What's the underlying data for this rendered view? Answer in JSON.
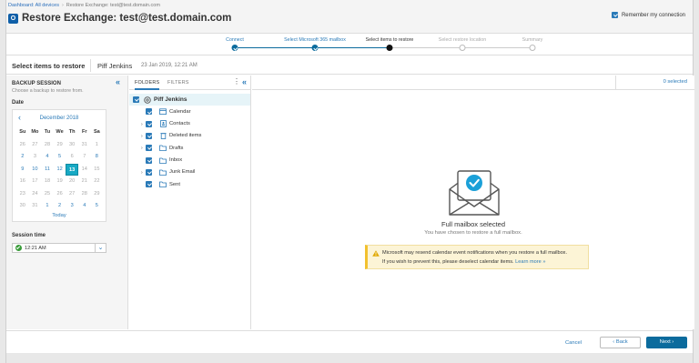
{
  "breadcrumb": {
    "link": "Dashboard: All devices",
    "current": "Restore Exchange: test@test.domain.com"
  },
  "app": {
    "logo_letter": "O",
    "title": "Restore Exchange: test@test.domain.com"
  },
  "remember": {
    "label": "Remember my connection",
    "checked": true
  },
  "steps": [
    {
      "label": "Connect",
      "state": "done"
    },
    {
      "label": "Select Microsoft 365 mailbox",
      "state": "done"
    },
    {
      "label": "Select items to restore",
      "state": "current"
    },
    {
      "label": "Select restore location",
      "state": "future"
    },
    {
      "label": "Summary",
      "state": "future"
    }
  ],
  "header": {
    "title": "Select items to restore",
    "user": "Piff Jenkins",
    "date": "23 Jan 2019, 12:21 AM"
  },
  "backup_session": {
    "title": "BACKUP SESSION",
    "subtitle": "Choose a backup to restore from.",
    "date_label": "Date",
    "session_time_label": "Session time",
    "session_time_value": "12:21 AM"
  },
  "calendar": {
    "month": "December 2018",
    "prev_icon": "‹",
    "weekdays": [
      "Su",
      "Mo",
      "Tu",
      "We",
      "Th",
      "Fr",
      "Sa"
    ],
    "weeks": [
      [
        {
          "d": "26",
          "s": "o"
        },
        {
          "d": "27",
          "s": "o"
        },
        {
          "d": "28",
          "s": "o"
        },
        {
          "d": "29",
          "s": "o"
        },
        {
          "d": "30",
          "s": "o"
        },
        {
          "d": "31",
          "s": "o"
        },
        {
          "d": "1",
          "s": "o"
        }
      ],
      [
        {
          "d": "2",
          "s": "a"
        },
        {
          "d": "3",
          "s": "o"
        },
        {
          "d": "4",
          "s": "a"
        },
        {
          "d": "5",
          "s": "a"
        },
        {
          "d": "6",
          "s": "o"
        },
        {
          "d": "7",
          "s": "o"
        },
        {
          "d": "8",
          "s": "a"
        }
      ],
      [
        {
          "d": "9",
          "s": "a"
        },
        {
          "d": "10",
          "s": "a"
        },
        {
          "d": "11",
          "s": "a"
        },
        {
          "d": "12",
          "s": "a"
        },
        {
          "d": "13",
          "s": "sel"
        },
        {
          "d": "14",
          "s": "o"
        },
        {
          "d": "15",
          "s": "o"
        }
      ],
      [
        {
          "d": "16",
          "s": "o"
        },
        {
          "d": "17",
          "s": "o"
        },
        {
          "d": "18",
          "s": "o"
        },
        {
          "d": "19",
          "s": "o"
        },
        {
          "d": "20",
          "s": "o"
        },
        {
          "d": "21",
          "s": "o"
        },
        {
          "d": "22",
          "s": "o"
        }
      ],
      [
        {
          "d": "23",
          "s": "o"
        },
        {
          "d": "24",
          "s": "o"
        },
        {
          "d": "25",
          "s": "o"
        },
        {
          "d": "26",
          "s": "o"
        },
        {
          "d": "27",
          "s": "o"
        },
        {
          "d": "28",
          "s": "o"
        },
        {
          "d": "29",
          "s": "o"
        }
      ],
      [
        {
          "d": "30",
          "s": "o"
        },
        {
          "d": "31",
          "s": "o"
        },
        {
          "d": "1",
          "s": "a"
        },
        {
          "d": "2",
          "s": "a"
        },
        {
          "d": "3",
          "s": "a"
        },
        {
          "d": "4",
          "s": "a"
        },
        {
          "d": "5",
          "s": "a"
        }
      ]
    ],
    "today_label": "Today"
  },
  "folders_panel": {
    "tab_folders": "FOLDERS",
    "tab_filters": "FILTERS",
    "root": "Piff Jenkins",
    "items": [
      {
        "label": "Calendar",
        "icon": "calendar-icon",
        "expandable": false
      },
      {
        "label": "Contacts",
        "icon": "contacts-icon",
        "expandable": true
      },
      {
        "label": "Deleted items",
        "icon": "trash-icon",
        "expandable": true
      },
      {
        "label": "Drafts",
        "icon": "folder-icon",
        "expandable": true
      },
      {
        "label": "Inbox",
        "icon": "folder-icon",
        "expandable": false
      },
      {
        "label": "Junk Email",
        "icon": "folder-icon",
        "expandable": true
      },
      {
        "label": "Sent",
        "icon": "folder-icon",
        "expandable": false
      }
    ]
  },
  "main": {
    "selected_count": "0 selected",
    "empty_title": "Full mailbox selected",
    "empty_subtitle": "You have chosen to restore a full mailbox.",
    "warning_line1": "Microsoft may resend calendar event notifications when you restore a full mailbox.",
    "warning_line2": "If you wish to prevent this, please deselect calendar items.",
    "learn_more": "Learn more »"
  },
  "footer": {
    "cancel": "Cancel",
    "back": "‹  Back",
    "next": "Next  ›"
  },
  "colors": {
    "accent": "#2a7ab8",
    "primary": "#0b6b9d",
    "selected_day": "#17a9c4",
    "warning_bg": "#fcf4d6",
    "warning_bar": "#f2c12e"
  }
}
